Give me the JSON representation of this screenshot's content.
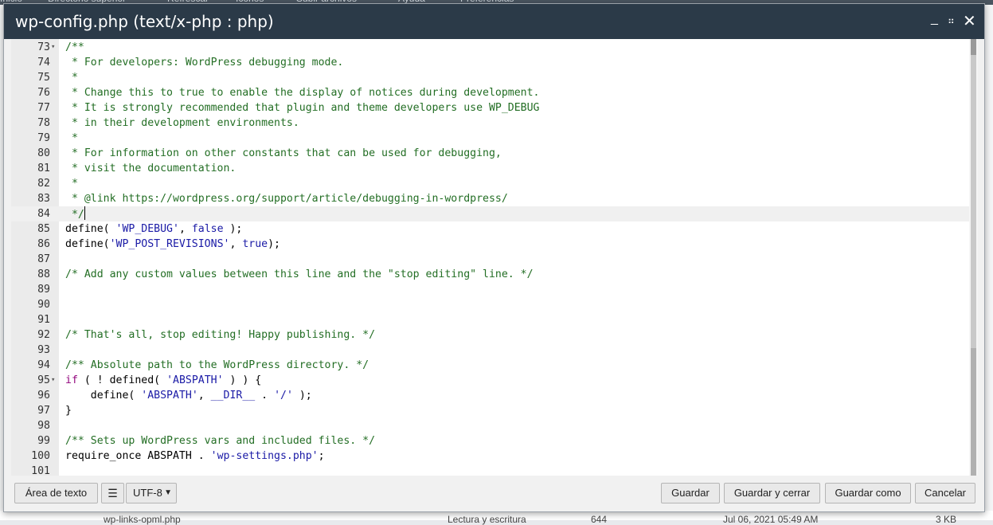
{
  "background": {
    "top_items": [
      "Inicio",
      "Directorio superior",
      "Refrescar",
      "Iconos",
      "Subir archivos",
      "Ayuda",
      "Preferencias"
    ],
    "bottom_row": {
      "name": "wp-links-opml.php",
      "permissions": "Lectura y escritura",
      "mode": "644",
      "date": "Jul 06, 2021 05:49 AM",
      "size": "3 KB"
    }
  },
  "dialog": {
    "title": "wp-config.php (text/x-php : php)",
    "minimize_icon": "_",
    "maximize_icon": "⠶",
    "close_icon": "✕"
  },
  "editor": {
    "active_line": 84,
    "lines": [
      {
        "n": "73",
        "fold": true,
        "text": "/**"
      },
      {
        "n": "74",
        "text": " * For developers: WordPress debugging mode."
      },
      {
        "n": "75",
        "text": " *"
      },
      {
        "n": "76",
        "text": " * Change this to true to enable the display of notices during development."
      },
      {
        "n": "77",
        "text": " * It is strongly recommended that plugin and theme developers use WP_DEBUG"
      },
      {
        "n": "78",
        "text": " * in their development environments."
      },
      {
        "n": "79",
        "text": " *"
      },
      {
        "n": "80",
        "text": " * For information on other constants that can be used for debugging,"
      },
      {
        "n": "81",
        "text": " * visit the documentation."
      },
      {
        "n": "82",
        "text": " *"
      },
      {
        "n": "83",
        "text": " * @link https://wordpress.org/support/article/debugging-in-wordpress/"
      },
      {
        "n": "84",
        "text": " */"
      },
      {
        "n": "85",
        "text": "define( 'WP_DEBUG', false );"
      },
      {
        "n": "86",
        "text": "define('WP_POST_REVISIONS', true);"
      },
      {
        "n": "87",
        "text": ""
      },
      {
        "n": "88",
        "text": "/* Add any custom values between this line and the \"stop editing\" line. */"
      },
      {
        "n": "89",
        "text": ""
      },
      {
        "n": "90",
        "text": ""
      },
      {
        "n": "91",
        "text": ""
      },
      {
        "n": "92",
        "text": "/* That's all, stop editing! Happy publishing. */"
      },
      {
        "n": "93",
        "text": ""
      },
      {
        "n": "94",
        "text": "/** Absolute path to the WordPress directory. */"
      },
      {
        "n": "95",
        "fold": true,
        "text": "if ( ! defined( 'ABSPATH' ) ) {"
      },
      {
        "n": "96",
        "text": "    define( 'ABSPATH', __DIR__ . '/' );"
      },
      {
        "n": "97",
        "text": "}"
      },
      {
        "n": "98",
        "text": ""
      },
      {
        "n": "99",
        "text": "/** Sets up WordPress vars and included files. */"
      },
      {
        "n": "100",
        "text": "require_once ABSPATH . 'wp-settings.php';"
      },
      {
        "n": "101",
        "text": ""
      }
    ]
  },
  "footer": {
    "wrap_label": "Área de texto",
    "options_icon": "sliders-icon",
    "encoding": "UTF-8",
    "save_label": "Guardar",
    "save_close_label": "Guardar y cerrar",
    "save_as_label": "Guardar como",
    "cancel_label": "Cancelar"
  },
  "colors": {
    "titlebar": "#2b3a48",
    "comment": "#236e24",
    "string": "#1a1aa6",
    "keyword": "#93067e"
  }
}
